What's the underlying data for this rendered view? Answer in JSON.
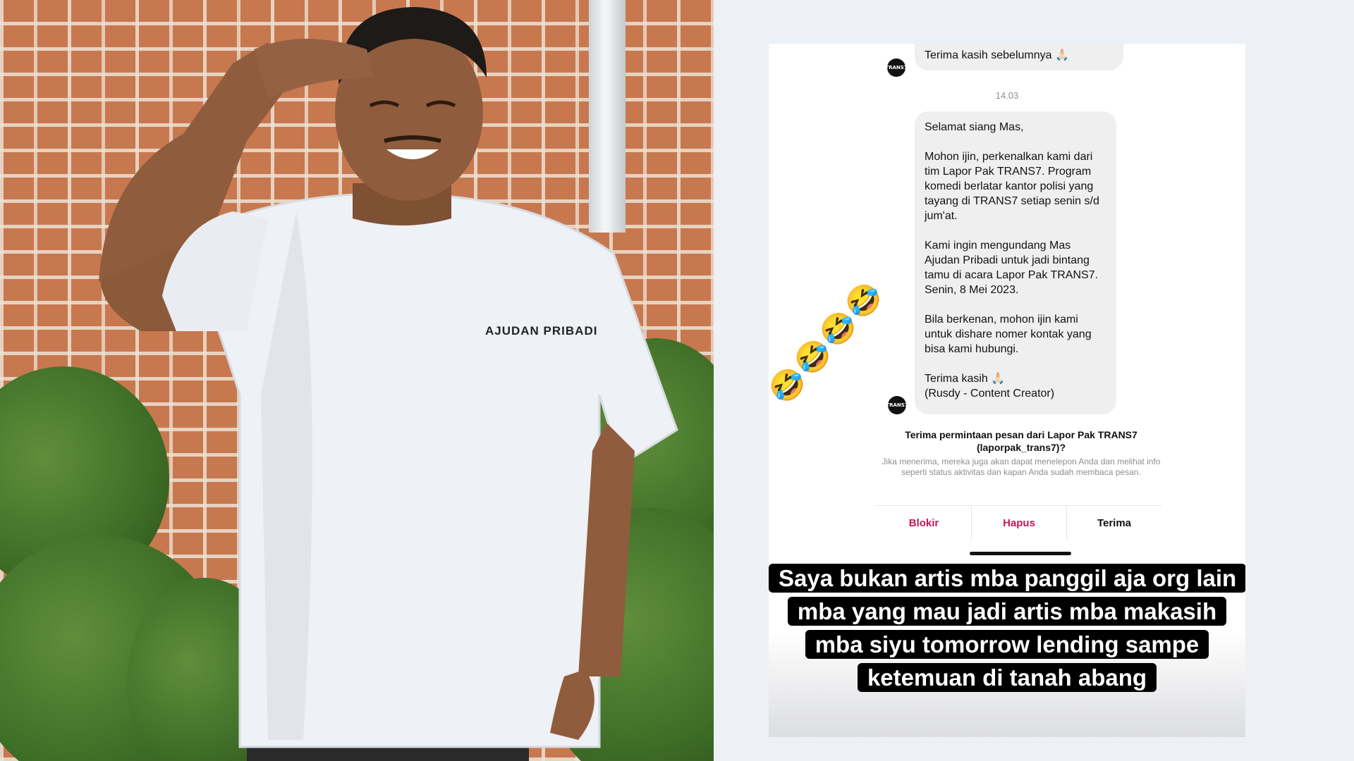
{
  "photo": {
    "shirt_text": "AJUDAN PRIBADI"
  },
  "chat": {
    "sender_avatar_label": "TRANS7",
    "first_message": "Terima kasih sebelumnya 🙏🏻",
    "timestamp": "14.03",
    "main_message": {
      "line1": "Selamat siang Mas,",
      "paragraph2": "Mohon ijin, perkenalkan kami dari tim Lapor Pak TRANS7. Program komedi berlatar kantor polisi yang tayang di TRANS7 setiap senin s/d jum'at.",
      "paragraph3": "Kami ingin mengundang Mas Ajudan Pribadi untuk jadi bintang tamu di acara Lapor Pak TRANS7. Senin, 8 Mei 2023.",
      "paragraph4": "Bila berkenan, mohon ijin kami untuk dishare nomer kontak yang bisa kami hubungi.",
      "closing": "Terima kasih 🙏🏻",
      "signature": "(Rusdy - Content Creator)"
    },
    "request_title": "Terima permintaan pesan dari Lapor Pak TRANS7 (laporpak_trans7)?",
    "request_desc": "Jika menerima, mereka juga akan dapat menelepon Anda dan melihat info seperti status aktivitas dan kapan Anda sudah membaca pesan.",
    "buttons": {
      "block": "Blokir",
      "delete": "Hapus",
      "accept": "Terima"
    },
    "emoji": "🤣",
    "caption": "Saya bukan artis mba panggil aja org lain mba yang mau jadi artis mba makasih mba siyu tomorrow lending sampe ketemuan di tanah abang"
  },
  "colors": {
    "accent_pink": "#c2185b",
    "caption_bg": "#000000"
  }
}
